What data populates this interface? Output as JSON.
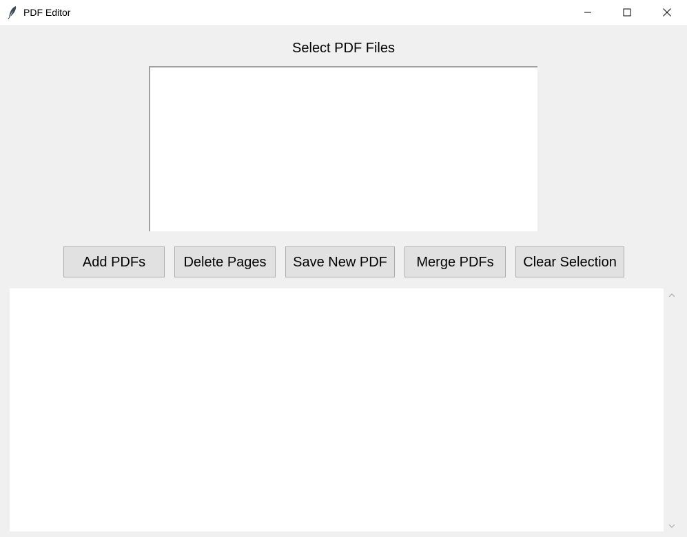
{
  "window": {
    "title": "PDF Editor"
  },
  "header": {
    "label": "Select PDF Files"
  },
  "file_list": {
    "items": []
  },
  "toolbar": {
    "add_label": "Add PDFs",
    "delete_label": "Delete Pages",
    "save_label": "Save New PDF",
    "merge_label": "Merge PDFs",
    "clear_label": "Clear Selection"
  },
  "output": {
    "text": ""
  },
  "icons": {
    "app": "feather-icon",
    "minimize": "minimize-icon",
    "maximize": "maximize-icon",
    "close": "close-icon",
    "scroll_up": "chevron-up-icon",
    "scroll_down": "chevron-down-icon"
  },
  "colors": {
    "window_bg": "#f0f0f0",
    "button_bg": "#e1e1e1",
    "button_border": "#adadad"
  }
}
